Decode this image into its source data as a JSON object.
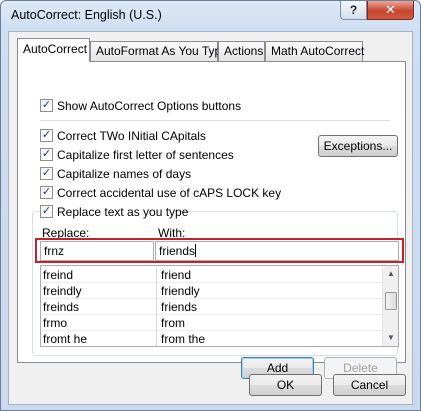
{
  "window": {
    "title": "AutoCorrect: English (U.S.)",
    "help_glyph": "?",
    "close_glyph": "✕"
  },
  "tabs": [
    {
      "label": "AutoCorrect",
      "active": true
    },
    {
      "label": "AutoFormat As You Type",
      "active": false
    },
    {
      "label": "Actions",
      "active": false
    },
    {
      "label": "Math AutoCorrect",
      "active": false
    }
  ],
  "options": {
    "show_buttons": {
      "label": "Show AutoCorrect Options buttons",
      "checked": true
    },
    "two_initial_caps": {
      "label": "Correct TWo INitial CApitals",
      "checked": true
    },
    "capitalize_sentences": {
      "label": "Capitalize first letter of sentences",
      "checked": true
    },
    "capitalize_days": {
      "label": "Capitalize names of days",
      "checked": true
    },
    "caps_lock": {
      "label": "Correct accidental use of cAPS LOCK key",
      "checked": true
    },
    "replace_text": {
      "label": "Replace text as you type",
      "checked": true
    }
  },
  "exceptions_label": "Exceptions...",
  "replace": {
    "replace_label": "Replace:",
    "with_label": "With:",
    "replace_value": "frnz",
    "with_value": "friends"
  },
  "entries": [
    {
      "replace": "freind",
      "with": "friend"
    },
    {
      "replace": "freindly",
      "with": "friendly"
    },
    {
      "replace": "freinds",
      "with": "friends"
    },
    {
      "replace": "frmo",
      "with": "from"
    },
    {
      "replace": "fromt he",
      "with": "from the"
    }
  ],
  "buttons": {
    "add": "Add",
    "delete": "Delete",
    "ok": "OK",
    "cancel": "Cancel"
  },
  "colors": {
    "highlight_box": "#c8202a",
    "check_mark": "#213d6b"
  }
}
